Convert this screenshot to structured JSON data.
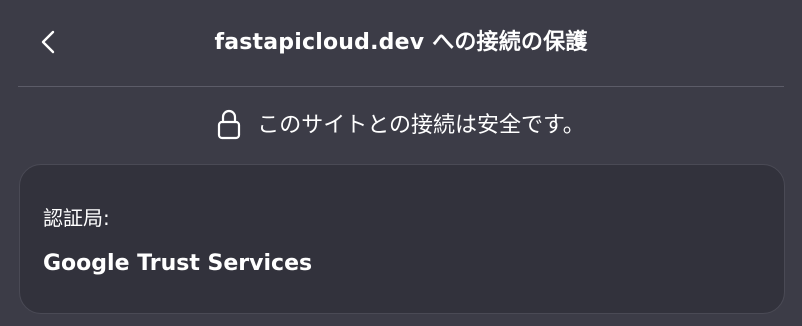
{
  "header": {
    "title": "fastapicloud.dev への接続の保護",
    "back_icon": "chevron-left-icon"
  },
  "security": {
    "icon": "lock-icon",
    "message": "このサイトとの接続は安全です。"
  },
  "certificate": {
    "issuer_label": "認証局:",
    "issuer_value": "Google Trust Services"
  },
  "colors": {
    "background": "#3c3c47",
    "card": "#32323c",
    "text": "#ffffff",
    "divider": "#5c5c68"
  }
}
